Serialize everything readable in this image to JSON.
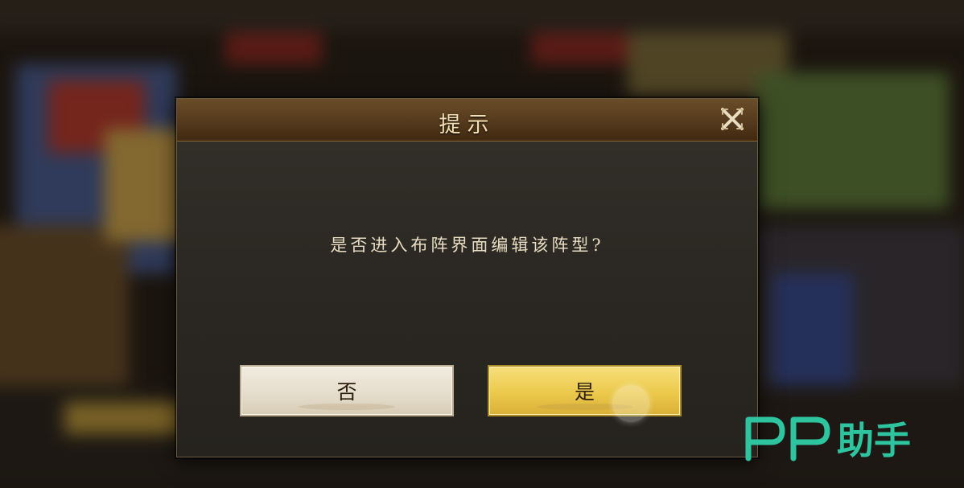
{
  "dialog": {
    "title": "提示",
    "message": "是否进入布阵界面编辑该阵型?",
    "no_label": "否",
    "yes_label": "是"
  },
  "watermark": {
    "text": "PP助手",
    "color": "#2ec4a0"
  },
  "icons": {
    "close": "close-x-icon"
  }
}
